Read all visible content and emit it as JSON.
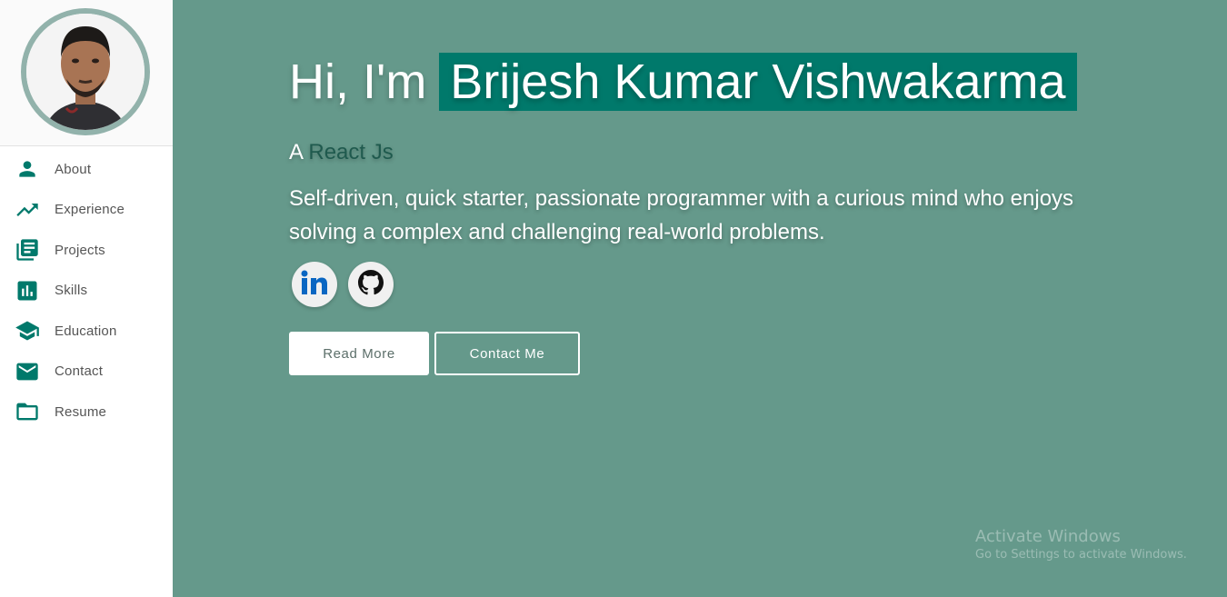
{
  "sidebar": {
    "items": [
      {
        "label": "About",
        "icon": "person-icon"
      },
      {
        "label": "Experience",
        "icon": "trending-up-icon"
      },
      {
        "label": "Projects",
        "icon": "library-books-icon"
      },
      {
        "label": "Skills",
        "icon": "bar-chart-icon"
      },
      {
        "label": "Education",
        "icon": "graduation-cap-icon"
      },
      {
        "label": "Contact",
        "icon": "mail-icon"
      },
      {
        "label": "Resume",
        "icon": "folder-icon"
      }
    ]
  },
  "hero": {
    "greeting": "Hi, I'm",
    "name": "Brijesh Kumar Vishwakarma",
    "role_prefix": "A",
    "role": "React Js",
    "bio": "Self-driven, quick starter, passionate programmer with a curious mind who enjoys solving a complex and challenging real-world problems.",
    "read_more": "Read More",
    "contact_me": "Contact Me"
  },
  "watermark": {
    "title": "Activate Windows",
    "subtitle": "Go to Settings to activate Windows."
  },
  "colors": {
    "accent": "#00796b",
    "main_bg": "#65998b",
    "avatar_ring": "#92b2ab"
  }
}
